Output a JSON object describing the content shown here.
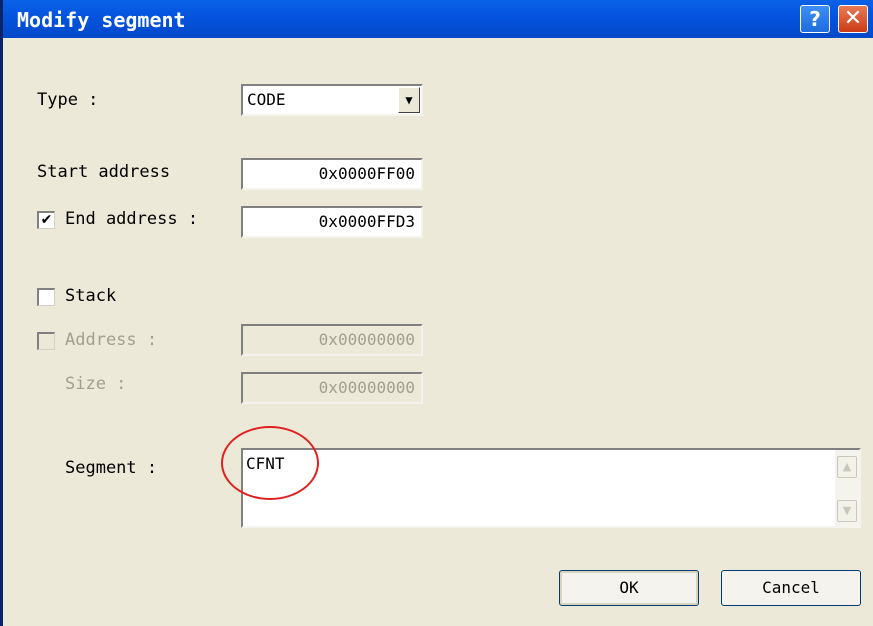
{
  "window": {
    "title": "Modify segment",
    "help_glyph": "?",
    "close_glyph": "✕"
  },
  "type_field": {
    "label": "Type :",
    "value": "CODE",
    "arrow_glyph": "▼"
  },
  "start_address": {
    "label": "Start address",
    "value": "0x0000FF00"
  },
  "end_address": {
    "label": "End address :",
    "checked": true,
    "check_glyph": "✔",
    "value": "0x0000FFD3"
  },
  "stack": {
    "label": "Stack",
    "checked": false
  },
  "stack_address": {
    "label": "Address :",
    "checked": false,
    "value": "0x00000000"
  },
  "stack_size": {
    "label": "Size :",
    "value": "0x00000000"
  },
  "segment": {
    "label": "Segment :",
    "value": "CFNT",
    "scroll_up_glyph": "▲",
    "scroll_down_glyph": "▼"
  },
  "buttons": {
    "ok": "OK",
    "cancel": "Cancel"
  },
  "colors": {
    "titlebar": "#0454e0",
    "dialog_bg": "#ece9d8",
    "annotation_circle": "#e02020"
  }
}
